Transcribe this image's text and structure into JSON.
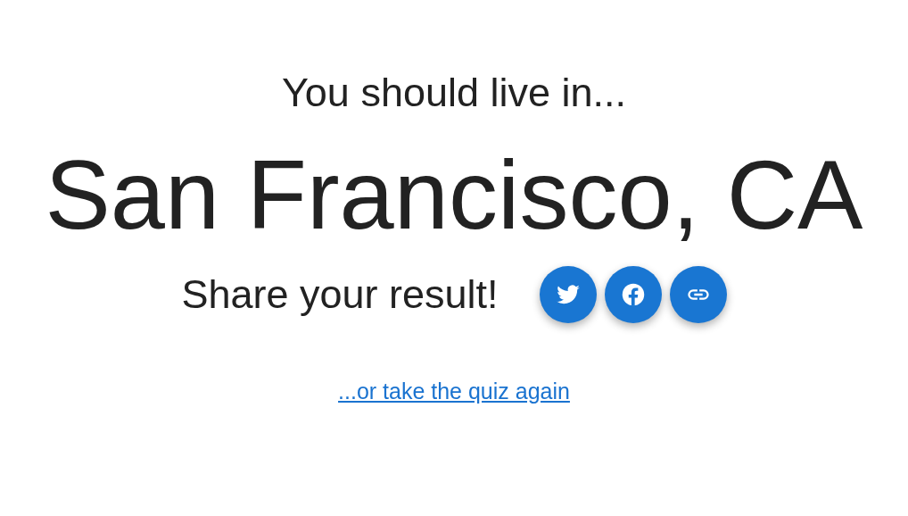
{
  "intro": "You should live in...",
  "result": "San Francisco, CA",
  "share": {
    "label": "Share your result!",
    "buttons": [
      {
        "kind": "twitter"
      },
      {
        "kind": "facebook"
      },
      {
        "kind": "link"
      }
    ]
  },
  "retake_link": "...or take the quiz again"
}
